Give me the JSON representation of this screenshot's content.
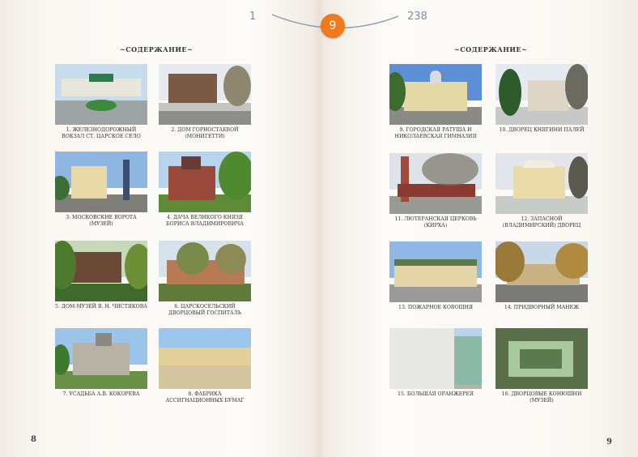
{
  "pager": {
    "first": "1",
    "current": "9",
    "last": "238"
  },
  "left_page": {
    "heading": "~СОДЕРЖАНИЕ~",
    "page_number": "8",
    "items": [
      {
        "caption": "1. Железнодорожный вокзал ст. Царское Село"
      },
      {
        "caption": "2. Дом Горностаевой (Монигетти)"
      },
      {
        "caption": "3. Московские ворота (музей)"
      },
      {
        "caption": "4. Дача Великого Князя Бориса Владимировича"
      },
      {
        "caption": "5. Дом-музей В. Н. Чистякова"
      },
      {
        "caption": "6. Царскосельский Дворцовый госпиталь"
      },
      {
        "caption": "7. Усадьба А.В. Кокорева"
      },
      {
        "caption": "8. Фабрика ассигнационных бумаг"
      }
    ]
  },
  "right_page": {
    "heading": "~СОДЕРЖАНИЕ~",
    "page_number": "9",
    "items": [
      {
        "caption": "9. Городская ратуша и Николаевская гимназия"
      },
      {
        "caption": "10. Дворец Княгини Палей"
      },
      {
        "caption": "11. Лютеранская церковь (кирха)"
      },
      {
        "caption": "12. Запасной (Владимирский) дворец"
      },
      {
        "caption": "13. Пожарное Ковошня"
      },
      {
        "caption": "14. Придворный манеж"
      },
      {
        "caption": "15. Большая оранжерея"
      },
      {
        "caption": "16. Дворцовые конюшни (музей)"
      }
    ]
  }
}
